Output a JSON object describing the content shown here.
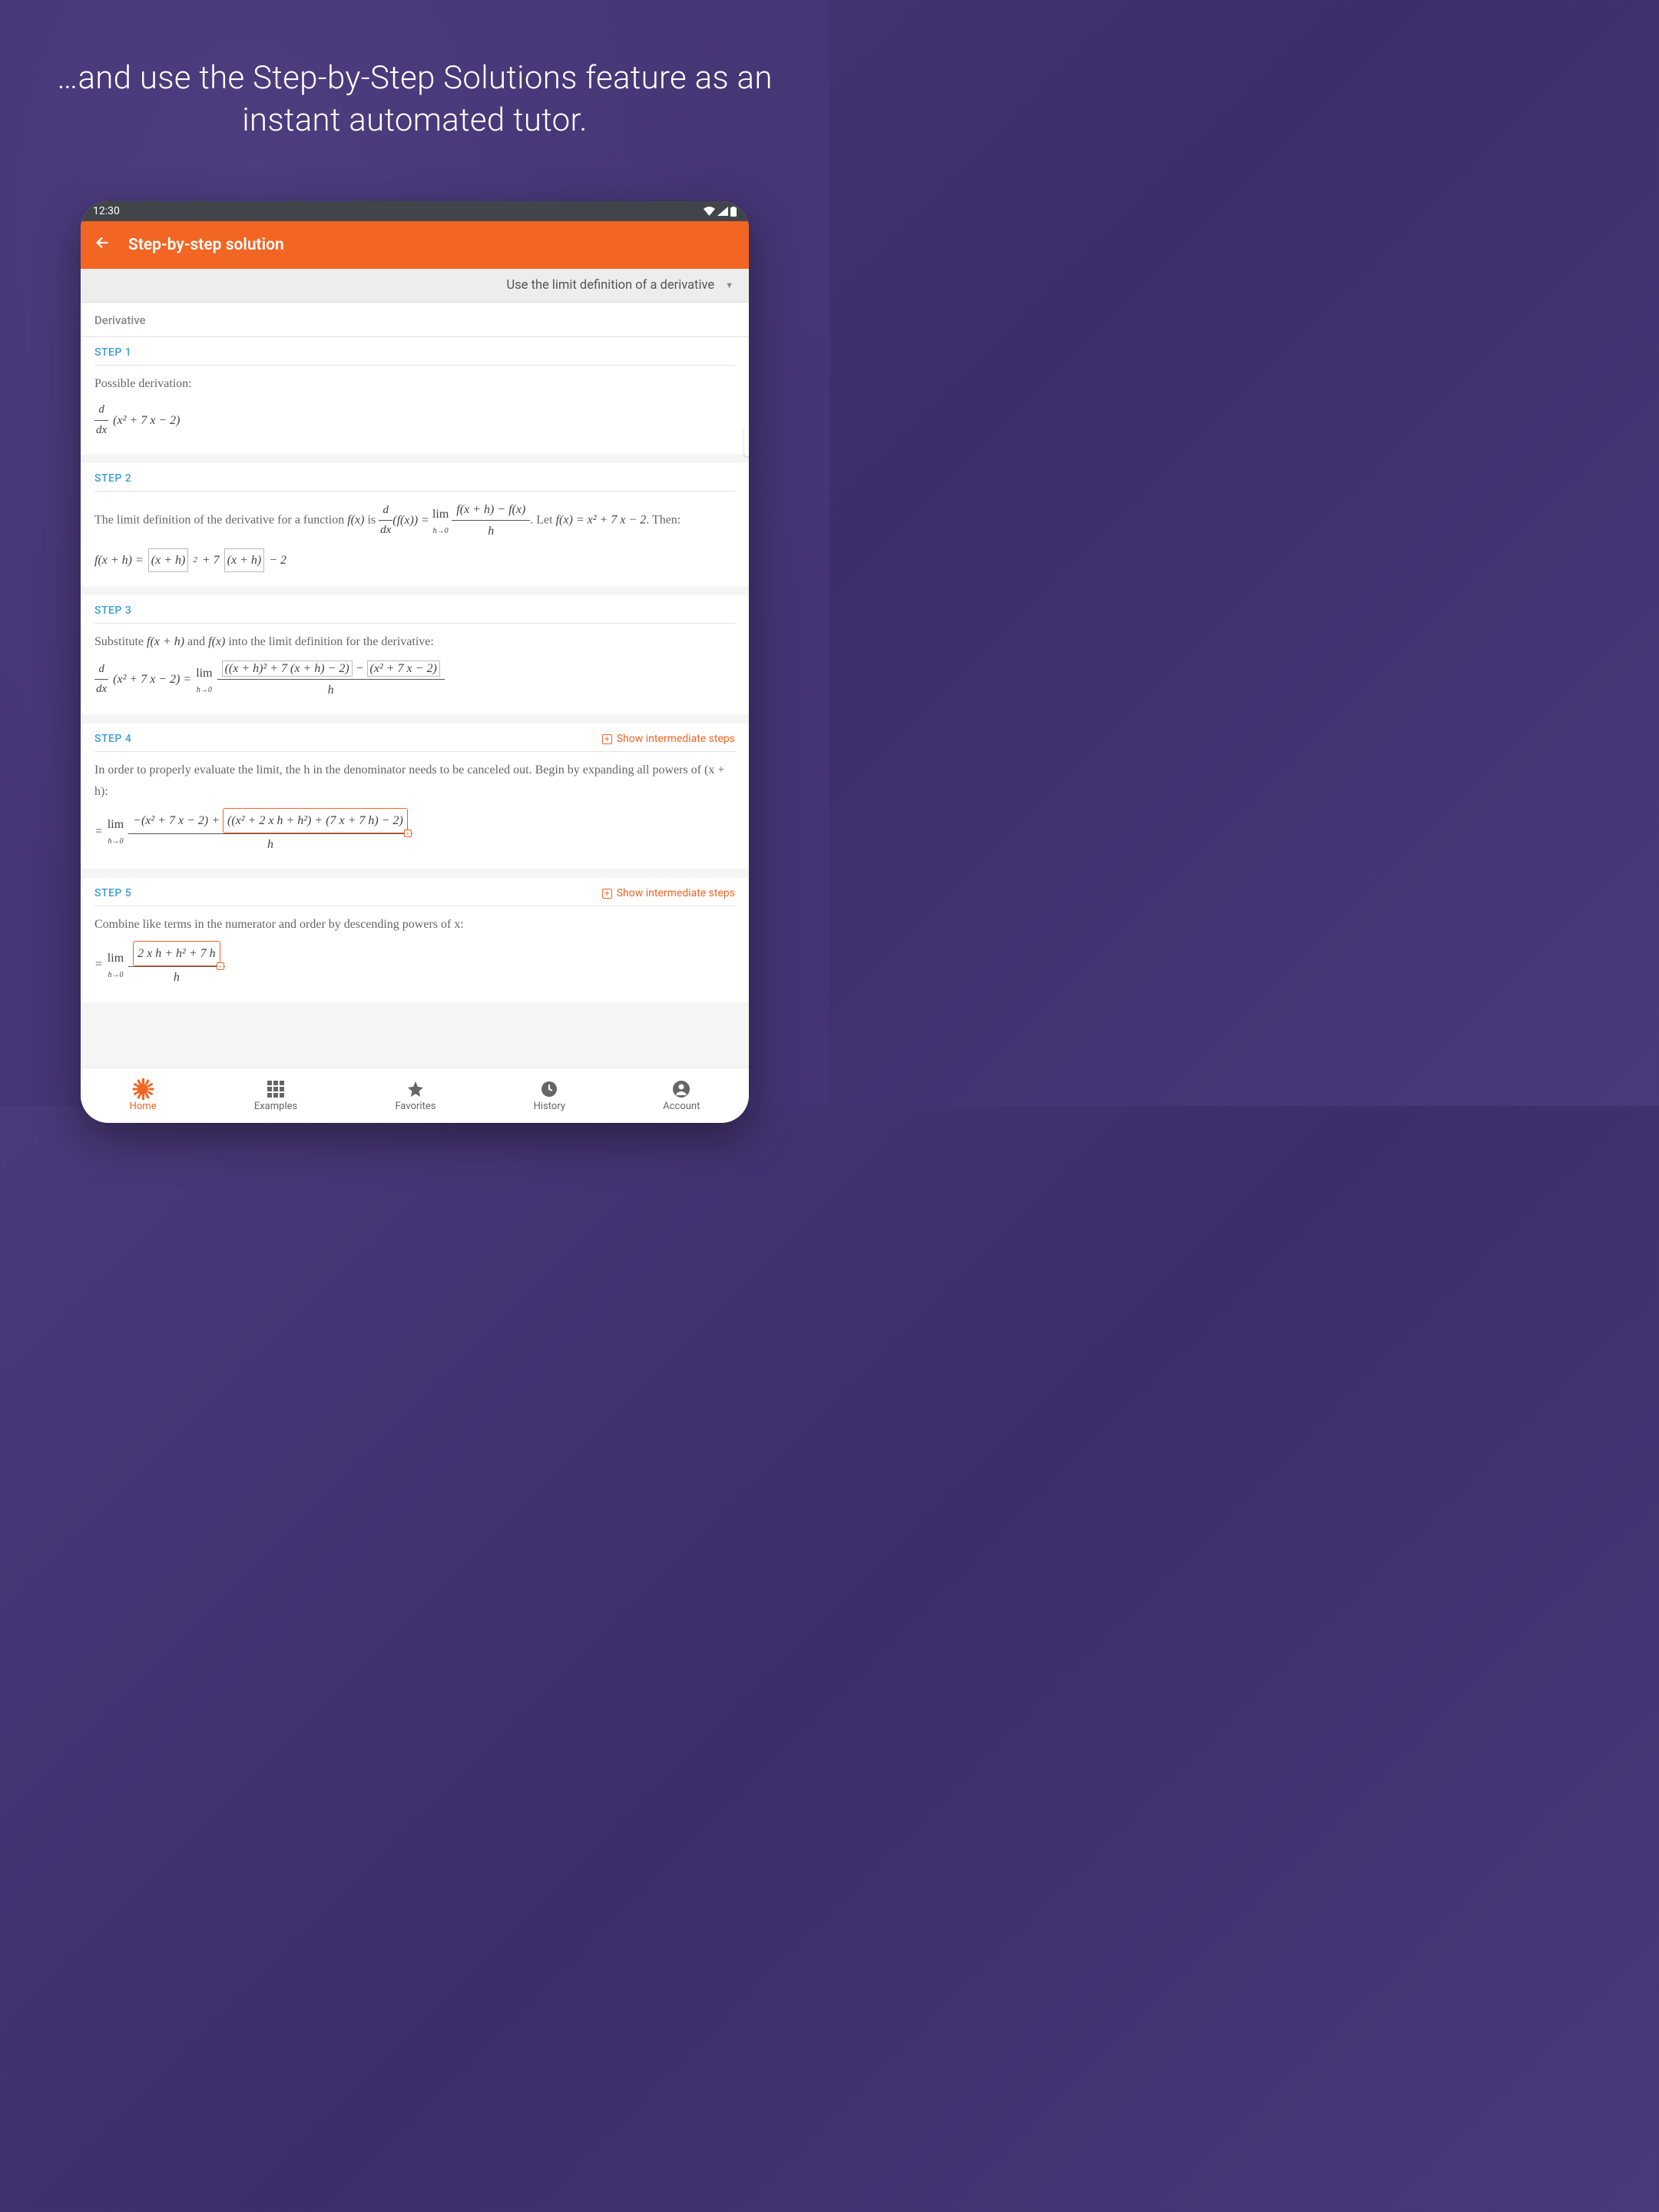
{
  "headline": "…and use the Step-by-Step Solutions feature as an instant automated tutor.",
  "status": {
    "time": "12:30"
  },
  "appbar": {
    "title": "Step-by-step solution"
  },
  "dropdown": {
    "selected": "Use the limit definition of a derivative"
  },
  "section_label": "Derivative",
  "steps": {
    "s1": {
      "label": "STEP 1",
      "text": "Possible derivation:",
      "expr_frac_num": "d",
      "expr_frac_den": "dx",
      "expr_rest": "(x² + 7 x − 2)"
    },
    "s2": {
      "label": "STEP 2",
      "text_a": "The limit definition of the derivative for a function ",
      "text_b": " is ",
      "text_c": ". Let ",
      "text_d": ". Then:",
      "fx": "f(x)",
      "dfdx_num": "d",
      "dfdx_den": "dx",
      "dfdx_arg": "(f(x)) = ",
      "lim_lbl": "lim",
      "lim_sub": "h→0",
      "lim_frac_num": "f(x + h) − f(x)",
      "lim_frac_den": "h",
      "let_expr": "f(x) = x² + 7 x − 2",
      "line2_lhs": "f(x + h) = ",
      "line2_b1": "(x + h)",
      "line2_plus": " + 7 ",
      "line2_b2": "(x + h)",
      "line2_end": " − 2"
    },
    "s3": {
      "label": "STEP 3",
      "text_a": "Substitute ",
      "fxh": "f(x + h)",
      "text_b": " and ",
      "fx": "f(x)",
      "text_c": " into the limit definition for the derivative:",
      "lhs_num": "d",
      "lhs_den": "dx",
      "lhs_arg": "(x² + 7 x − 2) = ",
      "lim_lbl": "lim",
      "lim_sub": "h→0",
      "rhs_box1": "((x + h)² + 7 (x + h) − 2)",
      "rhs_mid": " − ",
      "rhs_box2": "(x² + 7 x − 2)",
      "rhs_den": "h"
    },
    "s4": {
      "label": "STEP 4",
      "show_link": "Show intermediate steps",
      "text": "In order to properly evaluate the limit, the h in the denominator needs to be canceled out. Begin by expanding all powers of (x + h):",
      "eq_prefix": "= ",
      "lim_lbl": "lim",
      "lim_sub": "h→0",
      "num_a": "−(x² + 7 x − 2) + ",
      "num_box": "((x² + 2 x h + h²) + (7 x + 7 h) − 2)",
      "den": "h"
    },
    "s5": {
      "label": "STEP 5",
      "show_link": "Show intermediate steps",
      "text": "Combine like terms in the numerator and order by descending powers of x:",
      "eq_prefix": "= ",
      "lim_lbl": "lim",
      "lim_sub": "h→0",
      "num_box": "2 x h + h² + 7 h",
      "den": "h"
    }
  },
  "nav": {
    "home": "Home",
    "examples": "Examples",
    "favorites": "Favorites",
    "history": "History",
    "account": "Account"
  }
}
